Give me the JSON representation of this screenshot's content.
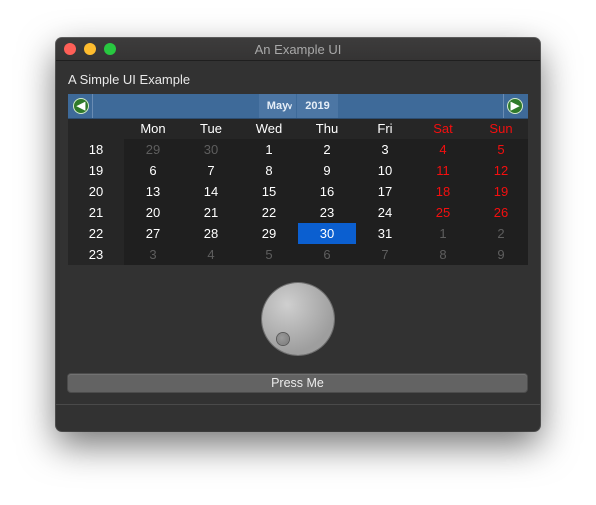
{
  "window": {
    "title": "An Example UI"
  },
  "heading": "A Simple UI Example",
  "calendar": {
    "month": "May",
    "year": "2019",
    "prev_icon": "arrow-left-icon",
    "next_icon": "arrow-right-icon",
    "weekdays": [
      "Mon",
      "Tue",
      "Wed",
      "Thu",
      "Fri",
      "Sat",
      "Sun"
    ],
    "week_numbers": [
      "18",
      "19",
      "20",
      "21",
      "22",
      "23"
    ],
    "rows": [
      [
        "29",
        "30",
        "1",
        "2",
        "3",
        "4",
        "5"
      ],
      [
        "6",
        "7",
        "8",
        "9",
        "10",
        "11",
        "12"
      ],
      [
        "13",
        "14",
        "15",
        "16",
        "17",
        "18",
        "19"
      ],
      [
        "20",
        "21",
        "22",
        "23",
        "24",
        "25",
        "26"
      ],
      [
        "27",
        "28",
        "29",
        "30",
        "31",
        "1",
        "2"
      ],
      [
        "3",
        "4",
        "5",
        "6",
        "7",
        "8",
        "9"
      ]
    ],
    "selected_date": "30",
    "weekend_color": "#f40f0f",
    "selection_color": "#0b5fd0"
  },
  "dial": {
    "icon": "dial-knob"
  },
  "button": {
    "label": "Press Me"
  }
}
